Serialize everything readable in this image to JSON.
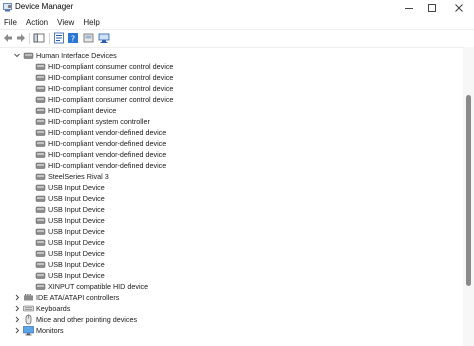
{
  "window": {
    "title": "Device Manager"
  },
  "menu": [
    "File",
    "Action",
    "View",
    "Help"
  ],
  "tree": {
    "category": "Human Interface Devices",
    "devices": [
      "HID-compliant consumer control device",
      "HID-compliant consumer control device",
      "HID-compliant consumer control device",
      "HID-compliant consumer control device",
      "HID-compliant device",
      "HID-compliant system controller",
      "HID-compliant vendor-defined device",
      "HID-compliant vendor-defined device",
      "HID-compliant vendor-defined device",
      "HID-compliant vendor-defined device",
      "SteelSeries Rival 3",
      "USB Input Device",
      "USB Input Device",
      "USB Input Device",
      "USB Input Device",
      "USB Input Device",
      "USB Input Device",
      "USB Input Device",
      "USB Input Device",
      "USB Input Device",
      "XINPUT compatible HID device"
    ],
    "other_categories": [
      {
        "label": "IDE ATA/ATAPI controllers",
        "icon": "ide-controller-icon"
      },
      {
        "label": "Keyboards",
        "icon": "keyboard-icon"
      },
      {
        "label": "Mice and other pointing devices",
        "icon": "mouse-icon"
      },
      {
        "label": "Monitors",
        "icon": "monitor-icon"
      }
    ]
  },
  "colors": {
    "accent": "#2b78d4",
    "scroll_thumb": "#8a8a8a"
  }
}
